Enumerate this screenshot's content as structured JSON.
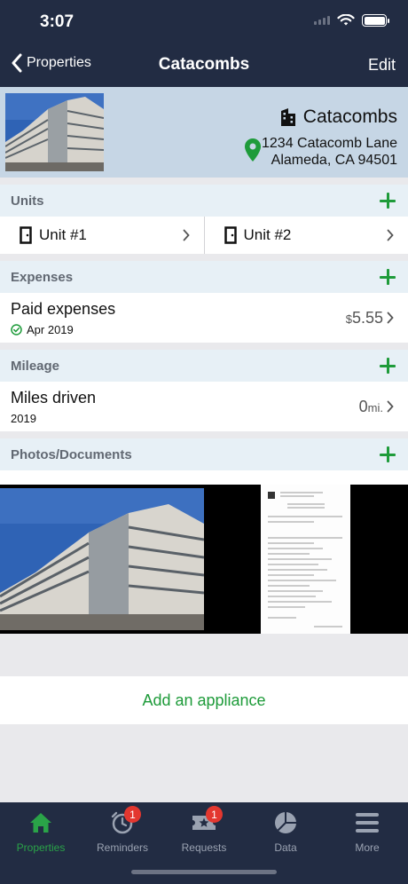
{
  "status": {
    "time": "3:07"
  },
  "nav": {
    "back_label": "Properties",
    "title": "Catacombs",
    "edit_label": "Edit"
  },
  "property": {
    "name": "Catacombs",
    "address_line1": "1234 Catacomb Lane",
    "address_line2": "Alameda, CA 94501"
  },
  "units": {
    "header": "Units",
    "items": [
      {
        "label": "Unit #1"
      },
      {
        "label": "Unit #2"
      }
    ]
  },
  "expenses": {
    "header": "Expenses",
    "title": "Paid expenses",
    "date": "Apr 2019",
    "currency": "$",
    "amount": "5.55"
  },
  "mileage": {
    "header": "Mileage",
    "title": "Miles driven",
    "year": "2019",
    "value": "0",
    "unit": "mi."
  },
  "photos": {
    "header": "Photos/Documents"
  },
  "appliance": {
    "label": "Add an appliance"
  },
  "tabs": [
    {
      "label": "Properties",
      "icon": "home-icon",
      "active": true
    },
    {
      "label": "Reminders",
      "icon": "alarm-clock-icon",
      "badge": "1"
    },
    {
      "label": "Requests",
      "icon": "ticket-star-icon",
      "badge": "1"
    },
    {
      "label": "Data",
      "icon": "pie-chart-icon"
    },
    {
      "label": "More",
      "icon": "menu-icon"
    }
  ],
  "colors": {
    "accent": "#1e9b3a",
    "nav_bg": "#222c43",
    "badge": "#e3372f",
    "section_bg": "#e7f0f6",
    "header_bg": "#c6d6e5"
  }
}
